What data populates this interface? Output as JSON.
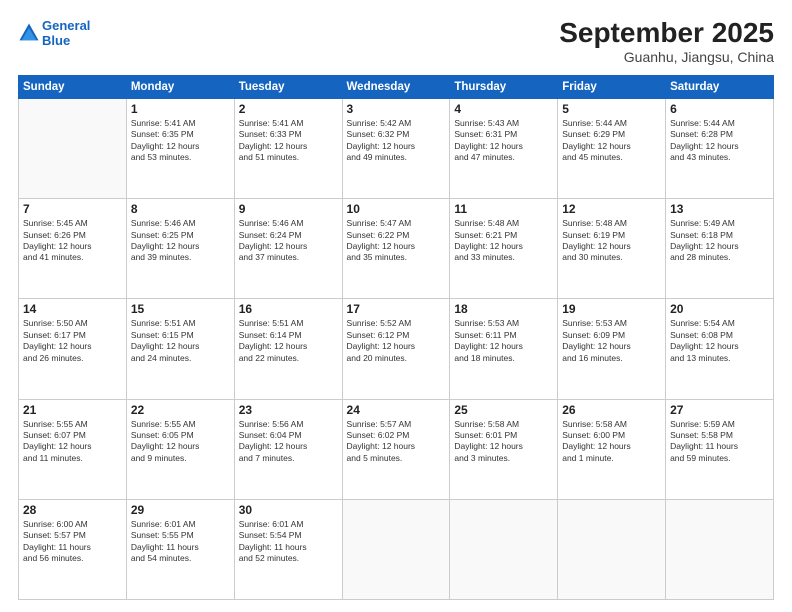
{
  "logo": {
    "line1": "General",
    "line2": "Blue"
  },
  "title": "September 2025",
  "location": "Guanhu, Jiangsu, China",
  "days_of_week": [
    "Sunday",
    "Monday",
    "Tuesday",
    "Wednesday",
    "Thursday",
    "Friday",
    "Saturday"
  ],
  "weeks": [
    [
      {
        "day": "",
        "info": ""
      },
      {
        "day": "1",
        "info": "Sunrise: 5:41 AM\nSunset: 6:35 PM\nDaylight: 12 hours\nand 53 minutes."
      },
      {
        "day": "2",
        "info": "Sunrise: 5:41 AM\nSunset: 6:33 PM\nDaylight: 12 hours\nand 51 minutes."
      },
      {
        "day": "3",
        "info": "Sunrise: 5:42 AM\nSunset: 6:32 PM\nDaylight: 12 hours\nand 49 minutes."
      },
      {
        "day": "4",
        "info": "Sunrise: 5:43 AM\nSunset: 6:31 PM\nDaylight: 12 hours\nand 47 minutes."
      },
      {
        "day": "5",
        "info": "Sunrise: 5:44 AM\nSunset: 6:29 PM\nDaylight: 12 hours\nand 45 minutes."
      },
      {
        "day": "6",
        "info": "Sunrise: 5:44 AM\nSunset: 6:28 PM\nDaylight: 12 hours\nand 43 minutes."
      }
    ],
    [
      {
        "day": "7",
        "info": "Sunrise: 5:45 AM\nSunset: 6:26 PM\nDaylight: 12 hours\nand 41 minutes."
      },
      {
        "day": "8",
        "info": "Sunrise: 5:46 AM\nSunset: 6:25 PM\nDaylight: 12 hours\nand 39 minutes."
      },
      {
        "day": "9",
        "info": "Sunrise: 5:46 AM\nSunset: 6:24 PM\nDaylight: 12 hours\nand 37 minutes."
      },
      {
        "day": "10",
        "info": "Sunrise: 5:47 AM\nSunset: 6:22 PM\nDaylight: 12 hours\nand 35 minutes."
      },
      {
        "day": "11",
        "info": "Sunrise: 5:48 AM\nSunset: 6:21 PM\nDaylight: 12 hours\nand 33 minutes."
      },
      {
        "day": "12",
        "info": "Sunrise: 5:48 AM\nSunset: 6:19 PM\nDaylight: 12 hours\nand 30 minutes."
      },
      {
        "day": "13",
        "info": "Sunrise: 5:49 AM\nSunset: 6:18 PM\nDaylight: 12 hours\nand 28 minutes."
      }
    ],
    [
      {
        "day": "14",
        "info": "Sunrise: 5:50 AM\nSunset: 6:17 PM\nDaylight: 12 hours\nand 26 minutes."
      },
      {
        "day": "15",
        "info": "Sunrise: 5:51 AM\nSunset: 6:15 PM\nDaylight: 12 hours\nand 24 minutes."
      },
      {
        "day": "16",
        "info": "Sunrise: 5:51 AM\nSunset: 6:14 PM\nDaylight: 12 hours\nand 22 minutes."
      },
      {
        "day": "17",
        "info": "Sunrise: 5:52 AM\nSunset: 6:12 PM\nDaylight: 12 hours\nand 20 minutes."
      },
      {
        "day": "18",
        "info": "Sunrise: 5:53 AM\nSunset: 6:11 PM\nDaylight: 12 hours\nand 18 minutes."
      },
      {
        "day": "19",
        "info": "Sunrise: 5:53 AM\nSunset: 6:09 PM\nDaylight: 12 hours\nand 16 minutes."
      },
      {
        "day": "20",
        "info": "Sunrise: 5:54 AM\nSunset: 6:08 PM\nDaylight: 12 hours\nand 13 minutes."
      }
    ],
    [
      {
        "day": "21",
        "info": "Sunrise: 5:55 AM\nSunset: 6:07 PM\nDaylight: 12 hours\nand 11 minutes."
      },
      {
        "day": "22",
        "info": "Sunrise: 5:55 AM\nSunset: 6:05 PM\nDaylight: 12 hours\nand 9 minutes."
      },
      {
        "day": "23",
        "info": "Sunrise: 5:56 AM\nSunset: 6:04 PM\nDaylight: 12 hours\nand 7 minutes."
      },
      {
        "day": "24",
        "info": "Sunrise: 5:57 AM\nSunset: 6:02 PM\nDaylight: 12 hours\nand 5 minutes."
      },
      {
        "day": "25",
        "info": "Sunrise: 5:58 AM\nSunset: 6:01 PM\nDaylight: 12 hours\nand 3 minutes."
      },
      {
        "day": "26",
        "info": "Sunrise: 5:58 AM\nSunset: 6:00 PM\nDaylight: 12 hours\nand 1 minute."
      },
      {
        "day": "27",
        "info": "Sunrise: 5:59 AM\nSunset: 5:58 PM\nDaylight: 11 hours\nand 59 minutes."
      }
    ],
    [
      {
        "day": "28",
        "info": "Sunrise: 6:00 AM\nSunset: 5:57 PM\nDaylight: 11 hours\nand 56 minutes."
      },
      {
        "day": "29",
        "info": "Sunrise: 6:01 AM\nSunset: 5:55 PM\nDaylight: 11 hours\nand 54 minutes."
      },
      {
        "day": "30",
        "info": "Sunrise: 6:01 AM\nSunset: 5:54 PM\nDaylight: 11 hours\nand 52 minutes."
      },
      {
        "day": "",
        "info": ""
      },
      {
        "day": "",
        "info": ""
      },
      {
        "day": "",
        "info": ""
      },
      {
        "day": "",
        "info": ""
      }
    ]
  ]
}
